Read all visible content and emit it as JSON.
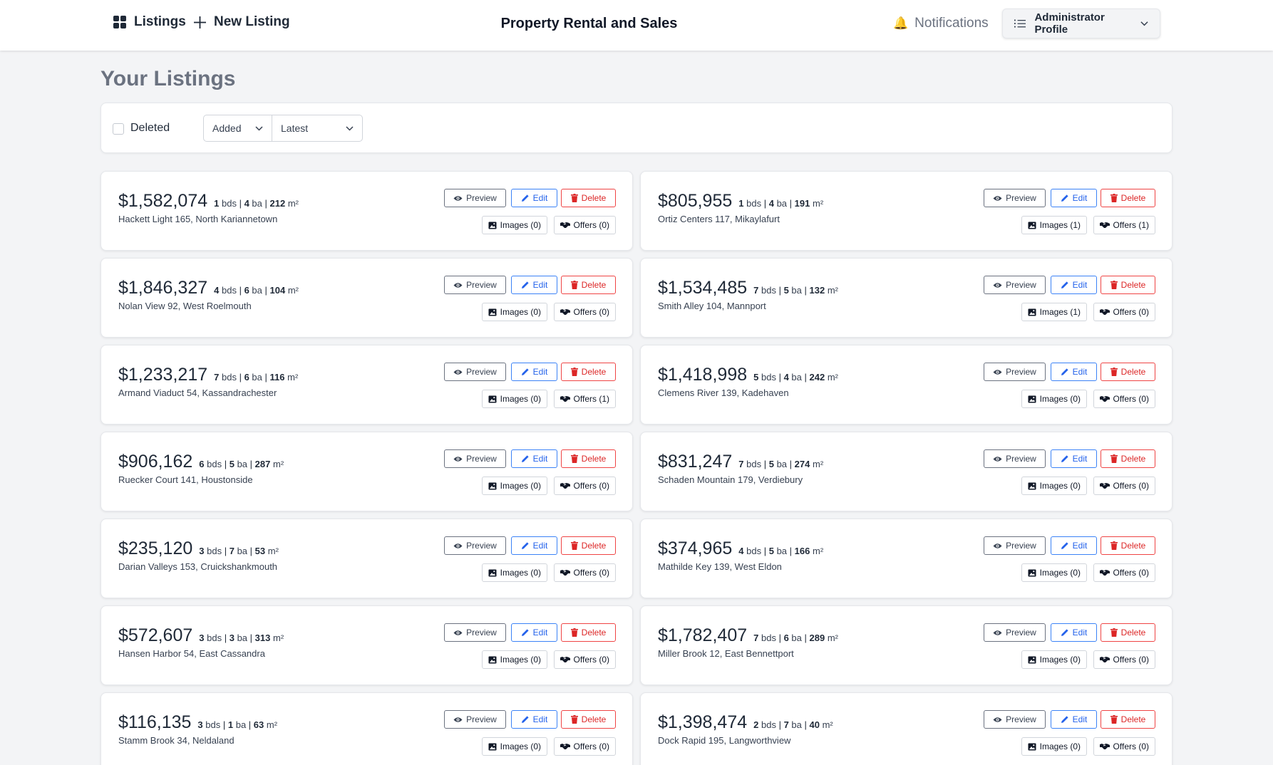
{
  "nav": {
    "listings_label": "Listings",
    "new_listing_label": "New Listing",
    "app_title": "Property Rental and Sales",
    "notifications_label": "Notifications",
    "profile_label": "Administrator Profile"
  },
  "page": {
    "title": "Your Listings"
  },
  "filters": {
    "deleted_label": "Deleted",
    "sort_field": "Added",
    "sort_order": "Latest"
  },
  "card_labels": {
    "preview": "Preview",
    "edit": "Edit",
    "delete": "Delete",
    "bds": "bds",
    "ba": "ba",
    "m2": "m²"
  },
  "listings": [
    {
      "price": "$1,582,074",
      "beds": "1",
      "baths": "4",
      "area": "212",
      "address": "Hackett Light 165, North Kariannetown",
      "images": "Images (0)",
      "offers": "Offers (0)"
    },
    {
      "price": "$805,955",
      "beds": "1",
      "baths": "4",
      "area": "191",
      "address": "Ortiz Centers 117, Mikaylafurt",
      "images": "Images (1)",
      "offers": "Offers (1)"
    },
    {
      "price": "$1,846,327",
      "beds": "4",
      "baths": "6",
      "area": "104",
      "address": "Nolan View 92, West Roelmouth",
      "images": "Images (0)",
      "offers": "Offers (0)"
    },
    {
      "price": "$1,534,485",
      "beds": "7",
      "baths": "5",
      "area": "132",
      "address": "Smith Alley 104, Mannport",
      "images": "Images (1)",
      "offers": "Offers (0)"
    },
    {
      "price": "$1,233,217",
      "beds": "7",
      "baths": "6",
      "area": "116",
      "address": "Armand Viaduct 54, Kassandrachester",
      "images": "Images (0)",
      "offers": "Offers (1)"
    },
    {
      "price": "$1,418,998",
      "beds": "5",
      "baths": "4",
      "area": "242",
      "address": "Clemens River 139, Kadehaven",
      "images": "Images (0)",
      "offers": "Offers (0)"
    },
    {
      "price": "$906,162",
      "beds": "6",
      "baths": "5",
      "area": "287",
      "address": "Ruecker Court 141, Houstonside",
      "images": "Images (0)",
      "offers": "Offers (0)"
    },
    {
      "price": "$831,247",
      "beds": "7",
      "baths": "5",
      "area": "274",
      "address": "Schaden Mountain 179, Verdiebury",
      "images": "Images (0)",
      "offers": "Offers (0)"
    },
    {
      "price": "$235,120",
      "beds": "3",
      "baths": "7",
      "area": "53",
      "address": "Darian Valleys 153, Cruickshankmouth",
      "images": "Images (0)",
      "offers": "Offers (0)"
    },
    {
      "price": "$374,965",
      "beds": "4",
      "baths": "5",
      "area": "166",
      "address": "Mathilde Key 139, West Eldon",
      "images": "Images (0)",
      "offers": "Offers (0)"
    },
    {
      "price": "$572,607",
      "beds": "3",
      "baths": "3",
      "area": "313",
      "address": "Hansen Harbor 54, East Cassandra",
      "images": "Images (0)",
      "offers": "Offers (0)"
    },
    {
      "price": "$1,782,407",
      "beds": "7",
      "baths": "6",
      "area": "289",
      "address": "Miller Brook 12, East Bennettport",
      "images": "Images (0)",
      "offers": "Offers (0)"
    },
    {
      "price": "$116,135",
      "beds": "3",
      "baths": "1",
      "area": "63",
      "address": "Stamm Brook 34, Neldaland",
      "images": "Images (0)",
      "offers": "Offers (0)"
    },
    {
      "price": "$1,398,474",
      "beds": "2",
      "baths": "7",
      "area": "40",
      "address": "Dock Rapid 195, Langworthview",
      "images": "Images (0)",
      "offers": "Offers (0)"
    }
  ]
}
